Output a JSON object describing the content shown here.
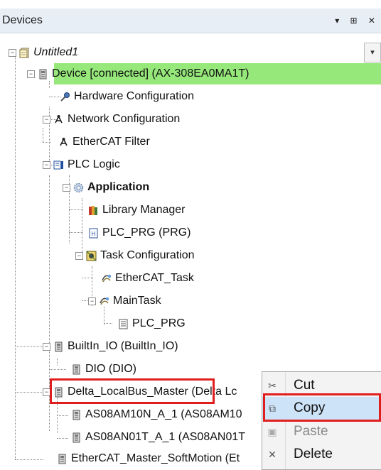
{
  "panel": {
    "title": "Devices",
    "header_icons": "▾ ⊞ ✕"
  },
  "combo": {
    "arrow": "▾"
  },
  "tree": [
    {
      "label": "Untitled1",
      "style": "italic",
      "icon": "project-icon"
    },
    {
      "label": "Device [connected] (AX-308EA0MA1T)",
      "icon": "device-icon"
    },
    {
      "label": "Hardware Configuration",
      "icon": "hardware-config-icon"
    },
    {
      "label": "Network Configuration",
      "icon": "network-icon"
    },
    {
      "label": "EtherCAT Filter",
      "icon": "network-icon"
    },
    {
      "label": "PLC Logic",
      "icon": "plc-logic-icon"
    },
    {
      "label": "Application",
      "style": "bold",
      "icon": "application-gear-icon"
    },
    {
      "label": "Library Manager",
      "icon": "library-icon"
    },
    {
      "label": "PLC_PRG (PRG)",
      "icon": "program-icon"
    },
    {
      "label": "Task Configuration",
      "icon": "task-config-icon"
    },
    {
      "label": "EtherCAT_Task",
      "icon": "task-icon"
    },
    {
      "label": "MainTask",
      "icon": "task-icon"
    },
    {
      "label": "PLC_PRG",
      "icon": "program-call-icon"
    },
    {
      "label": "BuiltIn_IO (BuiltIn_IO)",
      "icon": "device-icon"
    },
    {
      "label": "DIO (DIO)",
      "icon": "device-icon"
    },
    {
      "label": "Delta_LocalBus_Master",
      "icon": "device-icon",
      "suffix": " (Delta Lc"
    },
    {
      "label": "AS08AM10N_A_1 (AS08AM10",
      "icon": "device-icon"
    },
    {
      "label": "AS08AN01T_A_1 (AS08AN01T",
      "icon": "device-icon"
    },
    {
      "label": "EtherCAT_Master_SoftMotion (Et",
      "icon": "device-icon"
    }
  ],
  "context_menu": [
    {
      "label": "Cut",
      "icon": "cut-icon",
      "state": "normal"
    },
    {
      "label": "Copy",
      "icon": "copy-icon",
      "state": "selected"
    },
    {
      "label": "Paste",
      "icon": "paste-icon",
      "state": "disabled"
    },
    {
      "label": "Delete",
      "icon": "delete-icon",
      "state": "normal"
    }
  ],
  "colors": {
    "connected_highlight": "#96e87a",
    "callout": "#e01e1e",
    "menu_selected": "#cde3f7"
  }
}
